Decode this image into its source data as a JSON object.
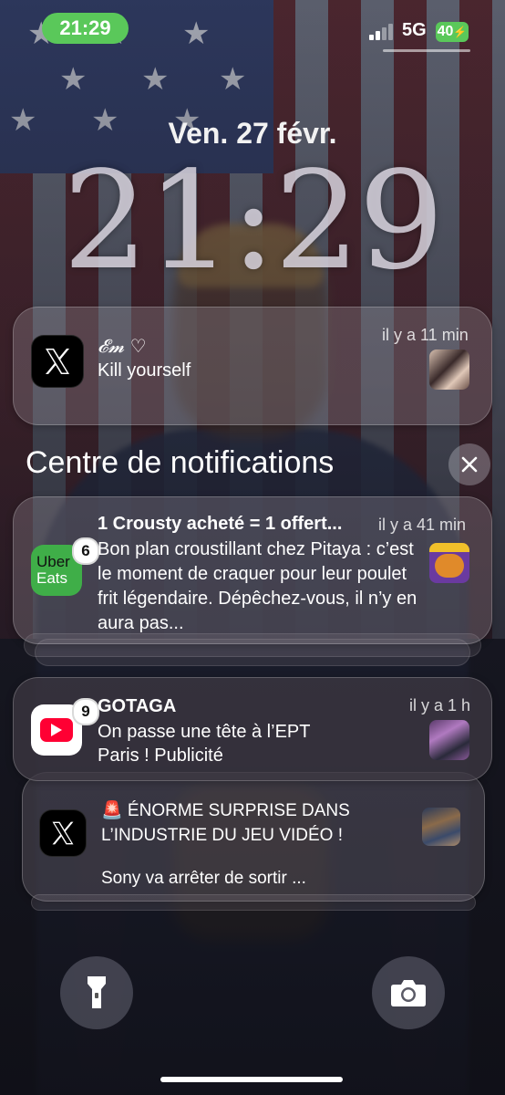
{
  "status_bar": {
    "time": "21:29",
    "network": "5G",
    "battery": "40"
  },
  "lock_screen": {
    "date": "Ven. 27 févr.",
    "clock": "21:29"
  },
  "notifications": {
    "pinned": {
      "app": "X",
      "sender": "𝓔𝓶 ♡",
      "message": "Kill yourself",
      "time": "il y a 11 min"
    },
    "centre_title": "Centre de notifications",
    "items": [
      {
        "app": "Uber Eats",
        "app_icon_text_1": "Uber",
        "app_icon_text_2": "Eats",
        "badge": "6",
        "title": "1 Crousty acheté = 1 offert...",
        "time": "il y a 41 min",
        "body": "Bon plan croustillant chez Pitaya : c’est le moment de craquer pour leur poulet frit légendaire. Dépêchez-vous, il n’y en aura pas..."
      },
      {
        "app": "YouTube",
        "badge": "9",
        "title": "GOTAGA",
        "time": "il y a 1 h",
        "body_line_1": "On passe une tête à l’EPT",
        "body_line_2": "Paris ! Publicité"
      },
      {
        "app": "X",
        "title_line_1": "🚨 ÉNORME SURPRISE DANS",
        "title_line_2": "L’INDUSTRIE DU JEU VIDÉO !",
        "body": "Sony va arrêter de sortir ..."
      }
    ]
  },
  "quick_actions": {
    "left": "flashlight-icon",
    "right": "camera-icon"
  },
  "colors": {
    "status_green": "#5ac85a",
    "uber_eats_green": "#3fae48",
    "youtube_red": "#ff0033",
    "x_black": "#000000"
  }
}
